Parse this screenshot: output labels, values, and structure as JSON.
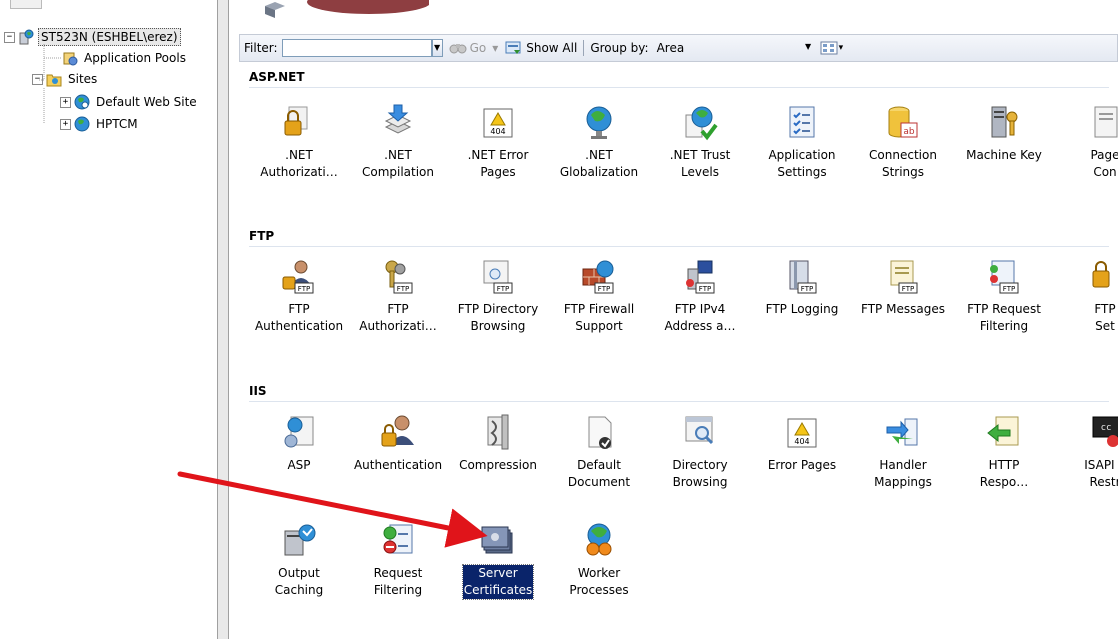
{
  "tree": {
    "root": {
      "label": "ST523N (ESHBEL\\erez)",
      "expander": "−"
    },
    "items": [
      {
        "label": "Application Pools"
      },
      {
        "label": "Sites",
        "expander": "−"
      },
      {
        "label": "Default Web Site",
        "expander": "+"
      },
      {
        "label": "HPTCM",
        "expander": "+"
      }
    ]
  },
  "toolbar": {
    "filter_label": "Filter:",
    "filter_value": "",
    "go_label": "Go",
    "show_all_label": "Show All",
    "group_by_label": "Group by:",
    "group_by_value": "Area"
  },
  "sections": [
    {
      "title": "ASP.NET",
      "features": [
        {
          "line1": ".NET",
          "line2": "Authorizati…",
          "icon": "lock-doc-icon"
        },
        {
          "line1": ".NET",
          "line2": "Compilation",
          "icon": "stack-download-icon"
        },
        {
          "line1": ".NET Error",
          "line2": "Pages",
          "icon": "error-404-icon"
        },
        {
          "line1": ".NET",
          "line2": "Globalization",
          "icon": "globe-icon"
        },
        {
          "line1": ".NET Trust",
          "line2": "Levels",
          "icon": "trust-globe-icon"
        },
        {
          "line1": "Application",
          "line2": "Settings",
          "icon": "checklist-icon"
        },
        {
          "line1": "Connection",
          "line2": "Strings",
          "icon": "database-ab-icon"
        },
        {
          "line1": "Machine Key",
          "line2": "",
          "icon": "server-key-icon"
        },
        {
          "line1": "Page",
          "line2": "Con",
          "icon": "page-icon"
        }
      ]
    },
    {
      "title": "FTP",
      "features": [
        {
          "line1": "FTP",
          "line2": "Authentication",
          "icon": "ftp-user-lock-icon"
        },
        {
          "line1": "FTP",
          "line2": "Authorizati…",
          "icon": "ftp-keys-icon"
        },
        {
          "line1": "FTP Directory",
          "line2": "Browsing",
          "icon": "ftp-browse-icon"
        },
        {
          "line1": "FTP Firewall",
          "line2": "Support",
          "icon": "ftp-firewall-icon"
        },
        {
          "line1": "FTP IPv4",
          "line2": "Address a…",
          "icon": "ftp-ipv4-icon"
        },
        {
          "line1": "FTP Logging",
          "line2": "",
          "icon": "ftp-log-icon"
        },
        {
          "line1": "FTP Messages",
          "line2": "",
          "icon": "ftp-messages-icon"
        },
        {
          "line1": "FTP Request",
          "line2": "Filtering",
          "icon": "ftp-filter-icon"
        },
        {
          "line1": "FTP",
          "line2": "Set",
          "icon": "ftp-settings-icon"
        }
      ]
    },
    {
      "title": "IIS",
      "features": [
        {
          "line1": "ASP",
          "line2": "",
          "icon": "asp-icon"
        },
        {
          "line1": "Authentication",
          "line2": "",
          "icon": "authentication-icon"
        },
        {
          "line1": "Compression",
          "line2": "",
          "icon": "compression-icon"
        },
        {
          "line1": "Default",
          "line2": "Document",
          "icon": "default-document-icon"
        },
        {
          "line1": "Directory",
          "line2": "Browsing",
          "icon": "directory-browsing-icon"
        },
        {
          "line1": "Error Pages",
          "line2": "",
          "icon": "error-pages-icon"
        },
        {
          "line1": "Handler",
          "line2": "Mappings",
          "icon": "handler-mappings-icon"
        },
        {
          "line1": "HTTP",
          "line2": "Respo…",
          "icon": "http-response-icon"
        },
        {
          "line1": "ISAPI a",
          "line2": "Restr",
          "icon": "isapi-icon"
        },
        {
          "line1": "Output",
          "line2": "Caching",
          "icon": "output-caching-icon"
        },
        {
          "line1": "Request",
          "line2": "Filtering",
          "icon": "request-filtering-icon"
        },
        {
          "line1": "Server",
          "line2": "Certificates",
          "icon": "server-certificates-icon",
          "selected": true
        },
        {
          "line1": "Worker",
          "line2": "Processes",
          "icon": "worker-processes-icon"
        }
      ]
    }
  ],
  "colors": {
    "selection_bg": "#0a246a",
    "annotation_arrow": "#e0141a",
    "header_rule": "#dde4ee"
  }
}
